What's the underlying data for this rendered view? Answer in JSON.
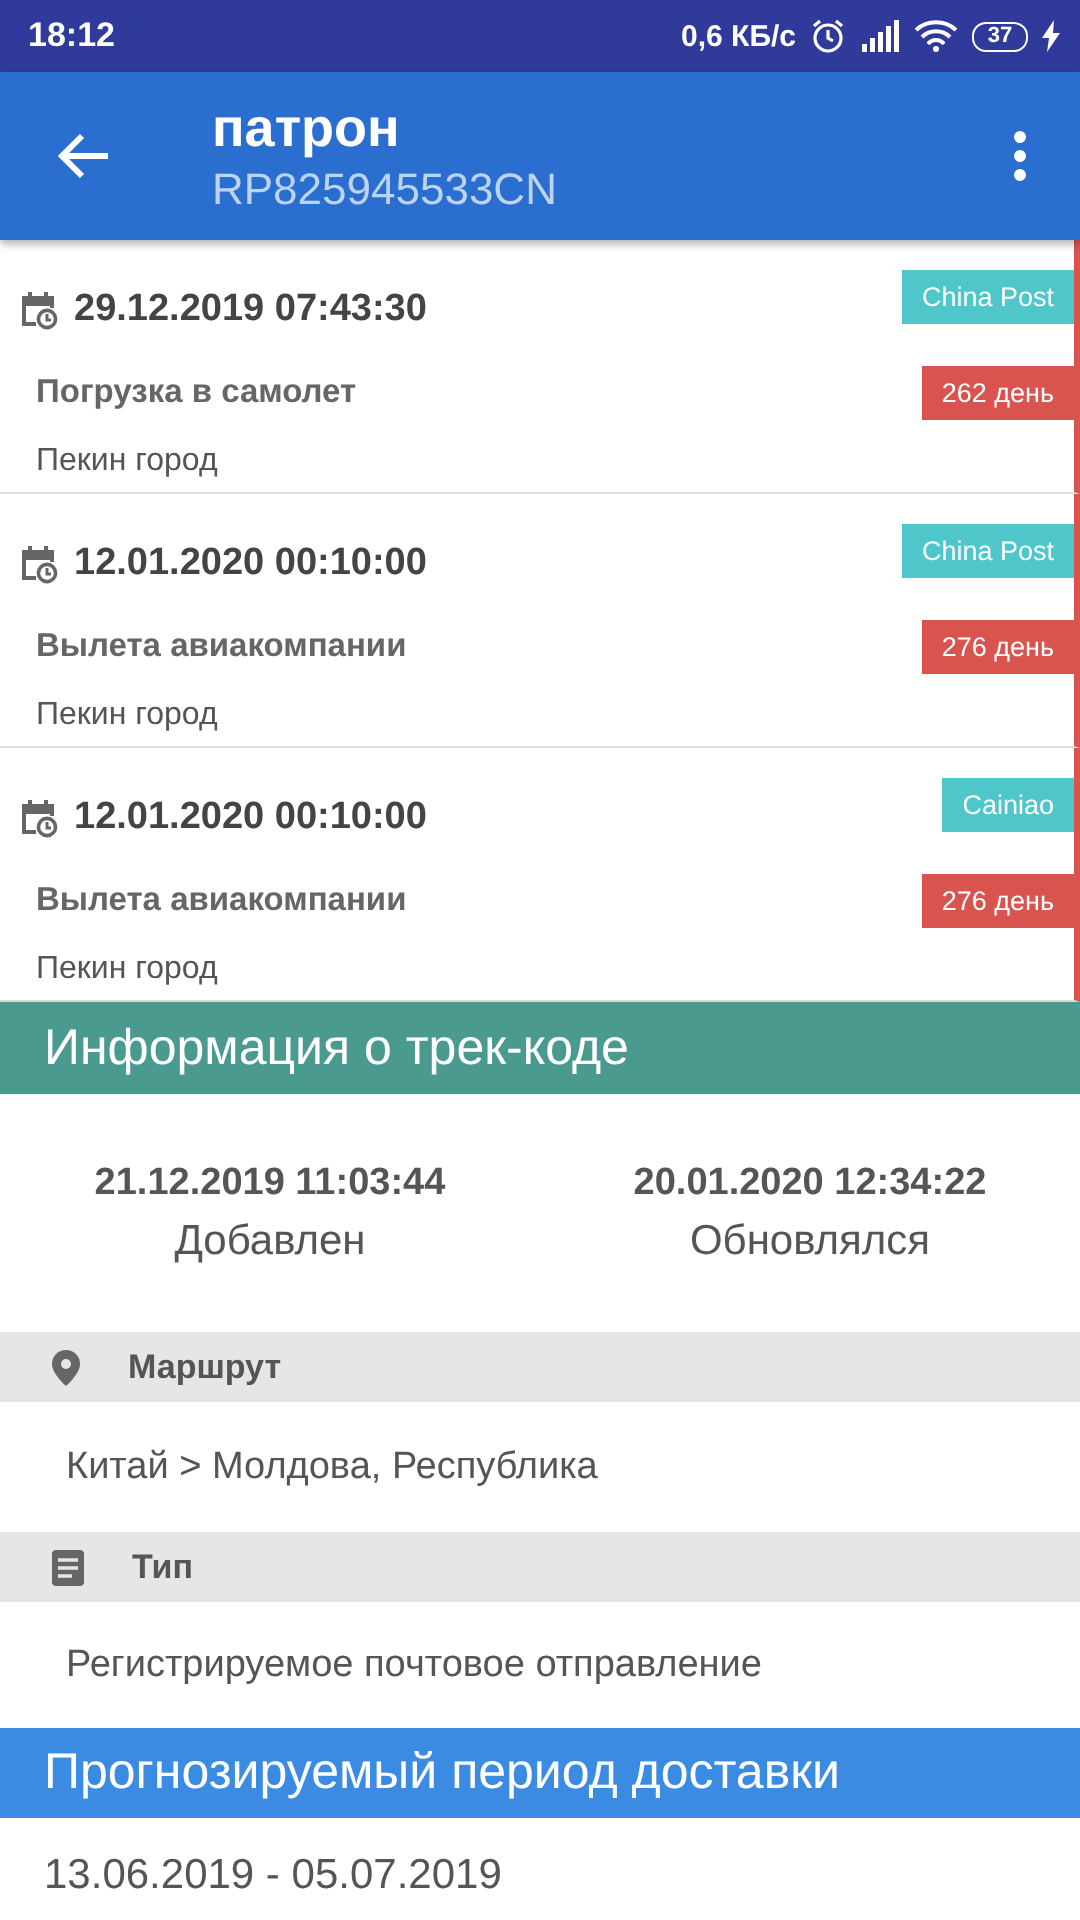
{
  "status_bar": {
    "time": "18:12",
    "speed": "0,6 КБ/с",
    "battery": "37"
  },
  "app_bar": {
    "title": "патрон",
    "subtitle": "RP825945533CN"
  },
  "events": [
    {
      "datetime": "29.12.2019 07:43:30",
      "carrier": "China Post",
      "status": "Погрузка в самолет",
      "days": "262 день",
      "location": "Пекин город"
    },
    {
      "datetime": "12.01.2020 00:10:00",
      "carrier": "China Post",
      "status": "Вылета авиакомпании",
      "days": "276 день",
      "location": "Пекин город"
    },
    {
      "datetime": "12.01.2020 00:10:00",
      "carrier": "Cainiao",
      "status": "Вылета авиакомпании",
      "days": "276 день",
      "location": "Пекин город"
    }
  ],
  "track_info": {
    "title": "Информация о трек-коде",
    "stamps": [
      {
        "value": "21.12.2019 11:03:44",
        "label": "Добавлен"
      },
      {
        "value": "20.01.2020 12:34:22",
        "label": "Обновлялся"
      }
    ],
    "fields": [
      {
        "kind": "route",
        "label": "Маршрут",
        "value": "Китай > Молдова, Республика"
      },
      {
        "kind": "type",
        "label": "Тип",
        "value": "Регистрируемое почтовое отправление"
      }
    ]
  },
  "delivery": {
    "title": "Прогнозируемый период доставки",
    "period": "13.06.2019 - 05.07.2019"
  }
}
